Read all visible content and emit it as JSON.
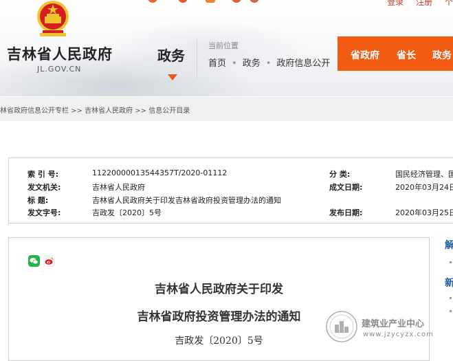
{
  "header": {
    "site_name": "吉林省人民政府",
    "site_domain": "JL.GOV.CN",
    "section_title": "政务",
    "top_links": [
      "登录",
      "注册",
      "个"
    ],
    "location_label": "当前位置",
    "location": [
      "首页",
      "政务",
      "政府信息公开"
    ],
    "nav": [
      "省政府",
      "省长",
      "政务"
    ],
    "colors": {
      "accent": "#f25c12",
      "emblem_red": "#d21f1f",
      "emblem_gold": "#f2c230"
    }
  },
  "breadcrumb": "林省政府信息公开专栏 >> 吉林省人民政府 >> 信息公开目录",
  "meta": {
    "index_label": "索 引 号:",
    "index_value": "11220000013544357T/2020-01112",
    "category_label": "分 类:",
    "category_value": "国民经济管理、国",
    "issuer_label": "发文机关:",
    "issuer_value": "吉林省人民政府",
    "date_label": "成文日期:",
    "date_value": "2020年03月24日",
    "title_label": "标 题:",
    "title_value": "吉林省人民政府关于印发吉林省政府投资管理办法的通知",
    "docno_label": "发文字号:",
    "docno_value": "吉政发〔2020〕5号",
    "pubdate_label": "发布日期:",
    "pubdate_value": "2020年03月25日"
  },
  "content": {
    "share_icons": [
      "wechat-icon",
      "weibo-icon"
    ],
    "title_line1": "吉林省人民政府关于印发",
    "title_line2": "吉林省政府投资管理办法的通知",
    "doc_number": "吉政发〔2020〕5号"
  },
  "sidebar": {
    "heading1": "解",
    "heading2": "新"
  },
  "watermark": {
    "name": "建筑业产业中心",
    "url": "www.jzycyzx.com"
  }
}
